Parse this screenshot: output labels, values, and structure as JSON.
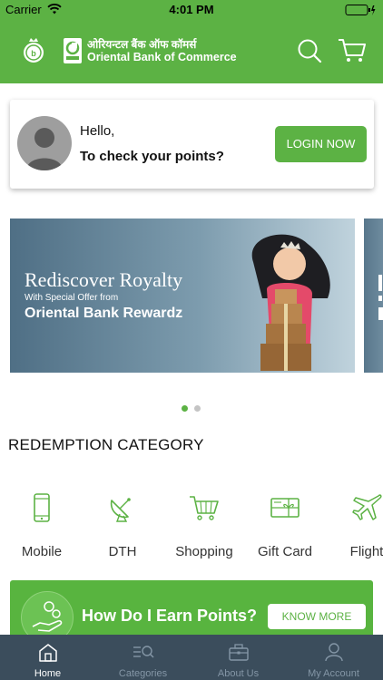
{
  "status_bar": {
    "carrier": "Carrier",
    "time": "4:01 PM"
  },
  "header": {
    "brand_hindi": "ओरियन्टल बैंक ऑफ कॉमर्स",
    "brand_english": "Oriental Bank of Commerce",
    "accent_color": "#5cb244"
  },
  "login_card": {
    "greeting": "Hello,",
    "prompt": "To check your points?",
    "login_button": "LOGIN NOW"
  },
  "banner": {
    "title": "Rediscover Royalty",
    "subtitle": "With Special Offer from",
    "brand": "Oriental Bank Rewardz",
    "active_slide": 1,
    "slide_count": 2
  },
  "redemption": {
    "title": "REDEMPTION CATEGORY",
    "categories": [
      {
        "label": "Mobile",
        "icon": "mobile-icon"
      },
      {
        "label": "DTH",
        "icon": "satellite-dish-icon"
      },
      {
        "label": "Shopping",
        "icon": "shopping-cart-icon"
      },
      {
        "label": "Gift Card",
        "icon": "gift-card-icon"
      },
      {
        "label": "Flight",
        "icon": "airplane-icon"
      }
    ]
  },
  "earn_banner": {
    "text": "How Do I Earn Points?",
    "button": "KNOW MORE"
  },
  "tabbar": {
    "tabs": [
      {
        "label": "Home",
        "icon": "home-icon",
        "active": true
      },
      {
        "label": "Categories",
        "icon": "categories-search-icon",
        "active": false
      },
      {
        "label": "About Us",
        "icon": "briefcase-icon",
        "active": false
      },
      {
        "label": "My Account",
        "icon": "user-icon",
        "active": false
      }
    ]
  }
}
